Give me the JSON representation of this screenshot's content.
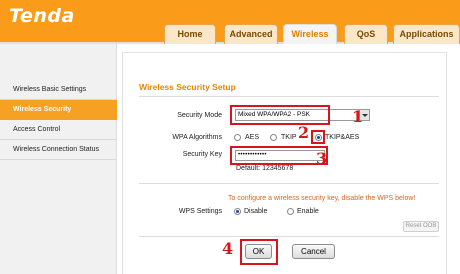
{
  "brand": {
    "logo": "Tenda"
  },
  "tabs": [
    {
      "label": "Home"
    },
    {
      "label": "Advanced"
    },
    {
      "label": "Wireless",
      "active": true
    },
    {
      "label": "QoS"
    },
    {
      "label": "Applications"
    }
  ],
  "sidebar": {
    "items": [
      {
        "label": "Wireless Basic Settings"
      },
      {
        "label": "Wireless Security",
        "active": true
      },
      {
        "label": "Access Control"
      },
      {
        "label": "Wireless Connection Status"
      }
    ]
  },
  "form": {
    "title": "Wireless Security Setup",
    "security_mode_label": "Security Mode",
    "security_mode_value": "Mixed WPA/WPA2 - PSK",
    "wpa_algorithms_label": "WPA Algorithms",
    "algorithms": [
      {
        "label": "AES",
        "selected": false
      },
      {
        "label": "TKIP",
        "selected": false
      },
      {
        "label": "TKIP&AES",
        "selected": true
      }
    ],
    "security_key_label": "Security Key",
    "security_key_value": "••••••••••••",
    "default_key_text": "Default: 12345678",
    "wps_info": "To configure a wireless security key, disable the WPS below!",
    "wps_settings_label": "WPS Settings",
    "wps_options": [
      {
        "label": "Disable",
        "selected": true
      },
      {
        "label": "Enable",
        "selected": false
      }
    ],
    "reset_oob_label": "Reset OOB",
    "ok_label": "OK",
    "cancel_label": "Cancel"
  },
  "annotations": {
    "n1": "1",
    "n2": "2",
    "n3": "3",
    "n4": "4"
  },
  "colors": {
    "brand_orange": "#fa9c1a",
    "active_nav": "#f6a024",
    "title_orange": "#e08800",
    "annotation_red": "#d8141c",
    "info_text": "#d2691e"
  }
}
